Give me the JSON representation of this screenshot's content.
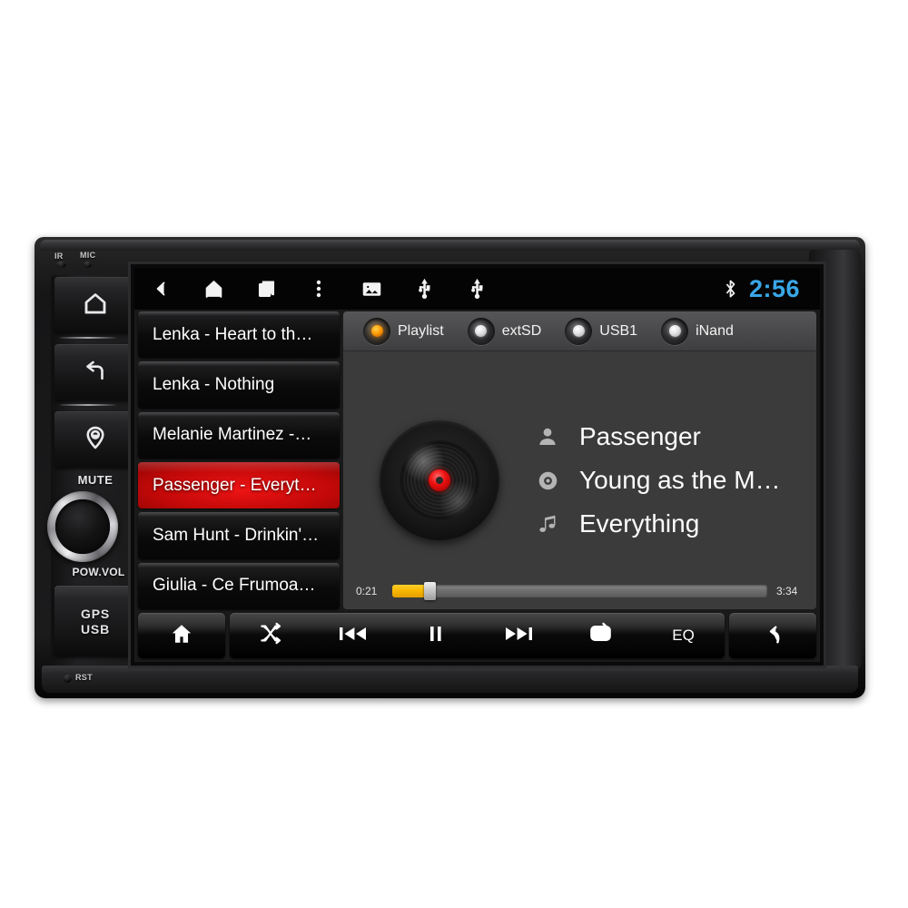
{
  "device": {
    "labels": {
      "ir": "IR",
      "mic": "MIC",
      "mute": "MUTE",
      "pow_vol": "POW.VOL",
      "gps": "GPS",
      "usb": "USB",
      "reset": "RST"
    },
    "hardware_buttons": [
      {
        "name": "home",
        "icon": "home-icon"
      },
      {
        "name": "back",
        "icon": "back-arrow-icon"
      },
      {
        "name": "navigation",
        "icon": "location-pin-icon"
      }
    ]
  },
  "statusbar": {
    "icons": [
      "back-icon",
      "home-icon",
      "recents-icon",
      "overflow-menu-icon",
      "screenshot-icon",
      "usb-icon",
      "usb-icon"
    ],
    "bluetooth_icon": "bluetooth-icon",
    "clock": "2:56",
    "clock_color": "#3aa7e8"
  },
  "playlist": {
    "items": [
      {
        "label": "Lenka - Heart to th…",
        "active": false
      },
      {
        "label": "Lenka - Nothing",
        "active": false
      },
      {
        "label": "Melanie Martinez -…",
        "active": false
      },
      {
        "label": "Passenger - Everyt…",
        "active": true
      },
      {
        "label": "Sam Hunt - Drinkin'…",
        "active": false
      },
      {
        "label": "Giulia - Ce Frumoa…",
        "active": false
      }
    ],
    "active_color": "#d00c0c"
  },
  "sources": {
    "options": [
      {
        "label": "Playlist",
        "selected": true
      },
      {
        "label": "extSD",
        "selected": false
      },
      {
        "label": "USB1",
        "selected": false
      },
      {
        "label": "iNand",
        "selected": false
      }
    ],
    "led_on_color": "#ff9b06",
    "led_off_color": "#e2e2e4"
  },
  "now_playing": {
    "album_art": "cd-disc-icon",
    "artist": "Passenger",
    "album": "Young as the M…",
    "title": "Everything",
    "icons": {
      "artist": "person-icon",
      "album": "disc-icon",
      "title": "music-note-icon"
    },
    "elapsed": "0:21",
    "duration": "3:34",
    "progress_percent": 10,
    "progress_color": "#f7b500"
  },
  "toolbar": {
    "home": {
      "label": "",
      "icon": "home-icon"
    },
    "buttons": [
      {
        "name": "shuffle",
        "label": "",
        "icon": "shuffle-icon"
      },
      {
        "name": "previous",
        "label": "",
        "icon": "previous-track-icon"
      },
      {
        "name": "pause",
        "label": "",
        "icon": "pause-icon"
      },
      {
        "name": "next",
        "label": "",
        "icon": "next-track-icon"
      },
      {
        "name": "repeat",
        "label": "",
        "icon": "repeat-icon"
      },
      {
        "name": "equalizer",
        "label": "EQ",
        "icon": ""
      }
    ],
    "return": {
      "label": "",
      "icon": "return-arrow-icon"
    }
  }
}
